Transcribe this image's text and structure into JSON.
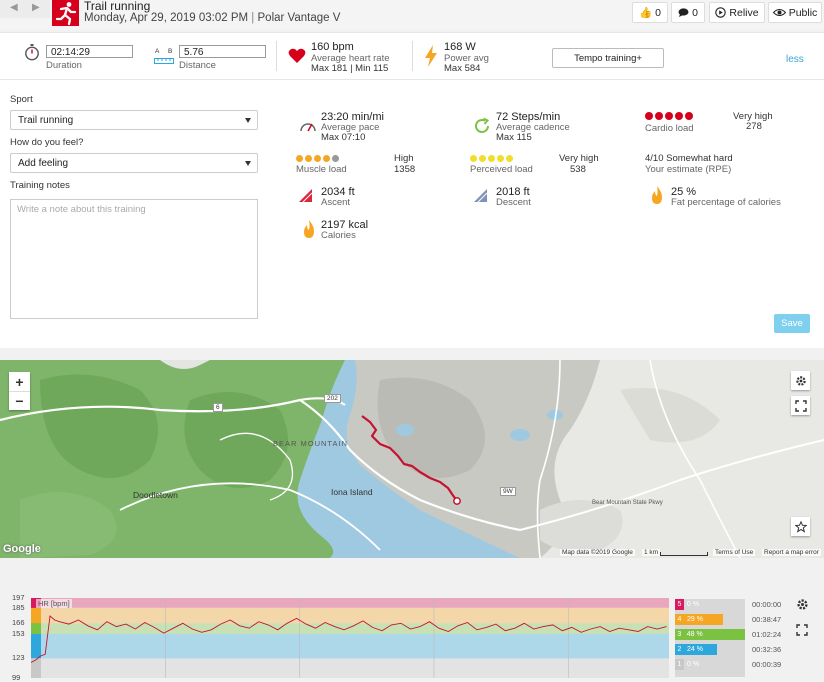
{
  "header": {
    "title": "Trail running",
    "date": "Monday, Apr 29, 2019 03:02 PM",
    "separator": "|",
    "device": "Polar Vantage V",
    "likes": "0",
    "comments": "0",
    "relive_label": "Relive",
    "visibility_label": "Public"
  },
  "summary": {
    "duration_value": "02:14:29",
    "duration_label": "Duration",
    "distance_prefix_a": "A",
    "distance_prefix_b": "B",
    "distance_value": "5.76",
    "distance_label": "Distance",
    "hr_value": "160 bpm",
    "hr_label": "Average heart rate",
    "hr_sub": "Max 181  |  Min 115",
    "power_value": "168 W",
    "power_label": "Power avg",
    "power_sub": "Max 584",
    "tempo_button": "Tempo training+",
    "less_link": "less"
  },
  "form": {
    "sport_label": "Sport",
    "sport_value": "Trail running",
    "feel_label": "How do you feel?",
    "feel_value": "Add feeling",
    "notes_label": "Training notes",
    "notes_placeholder": "Write a note about this training",
    "save_label": "Save"
  },
  "metrics": {
    "pace_value": "23:20 min/mi",
    "pace_label": "Average pace",
    "pace_sub": "Max 07:10",
    "cadence_value": "72 Steps/min",
    "cadence_label": "Average cadence",
    "cadence_sub": "Max 115",
    "cardio_label": "Cardio load",
    "cardio_level": "Very high",
    "cardio_value": "278",
    "cardio_dots_filled": 5,
    "muscle_label": "Muscle load",
    "muscle_level": "High",
    "muscle_value": "1358",
    "muscle_dots_filled": 4,
    "perceived_label": "Perceived load",
    "perceived_level": "Very high",
    "perceived_value": "538",
    "perceived_dots_filled": 5,
    "rpe_value": "4/10 Somewhat hard",
    "rpe_label": "Your estimate (RPE)",
    "ascent_value": "2034 ft",
    "ascent_label": "Ascent",
    "descent_value": "2018 ft",
    "descent_label": "Descent",
    "fat_value": "25 %",
    "fat_label": "Fat percentage of calories",
    "calories_value": "2197 kcal",
    "calories_label": "Calories"
  },
  "map": {
    "label_bear_mountain": "BEAR MOUNTAIN",
    "label_iona": "Iona Island",
    "label_doodletown": "Doodletown",
    "label_parkway": "Bear Mountain State Pkwy",
    "route_6": "6",
    "route_202": "202",
    "route_9w": "9W",
    "google": "Google",
    "map_data": "Map data ©2019 Google",
    "scale": "1 km",
    "terms": "Terms of Use",
    "report": "Report a map error"
  },
  "chart_data": {
    "type": "line",
    "title": "HR [bpm]",
    "y_ticks": [
      99,
      123,
      153,
      166,
      185,
      197
    ],
    "ylim": [
      99,
      197
    ],
    "x_range": [
      0,
      134.5
    ],
    "series": [
      {
        "name": "HR [bpm]",
        "x": [
          0,
          1,
          2,
          3,
          4,
          5,
          6,
          8,
          10,
          12,
          14,
          16,
          18,
          20,
          22,
          24,
          26,
          28,
          30,
          32,
          34,
          36,
          38,
          40,
          42,
          44,
          46,
          48,
          50,
          52,
          54,
          56,
          58,
          60,
          62,
          64,
          66,
          68,
          70,
          72,
          74,
          76,
          78,
          80,
          82,
          84,
          86,
          88,
          90,
          92,
          94,
          96,
          98,
          100,
          102,
          104,
          106,
          108,
          110,
          112,
          114,
          116,
          118,
          120,
          122,
          124,
          126,
          128,
          130,
          132,
          134
        ],
        "values": [
          118,
          121,
          126,
          128,
          175,
          170,
          168,
          165,
          170,
          163,
          158,
          168,
          162,
          165,
          159,
          167,
          161,
          154,
          160,
          166,
          159,
          155,
          158,
          165,
          170,
          163,
          160,
          168,
          164,
          158,
          166,
          172,
          165,
          160,
          167,
          162,
          158,
          163,
          169,
          161,
          157,
          164,
          166,
          159,
          162,
          168,
          160,
          156,
          163,
          167,
          158,
          161,
          165,
          157,
          160,
          166,
          159,
          162,
          164,
          157,
          161,
          155,
          159,
          162,
          156,
          160,
          158,
          156,
          162,
          159,
          162
        ]
      }
    ],
    "zones": [
      {
        "zone": "5",
        "percent": "0 %",
        "time": "00:00:00",
        "color": "#d81b60",
        "range": [
          185,
          197
        ]
      },
      {
        "zone": "4",
        "percent": "29 %",
        "time": "00:38:47",
        "color": "#f5a623",
        "range": [
          166,
          185
        ]
      },
      {
        "zone": "3",
        "percent": "48 %",
        "time": "01:02:24",
        "color": "#7cc242",
        "range": [
          153,
          166
        ]
      },
      {
        "zone": "2",
        "percent": "24 %",
        "time": "00:32:36",
        "color": "#2ea8dc",
        "range": [
          123,
          153
        ]
      },
      {
        "zone": "1",
        "percent": "0 %",
        "time": "00:00:39",
        "color": "#c8c8c8",
        "range": [
          99,
          123
        ]
      }
    ]
  }
}
